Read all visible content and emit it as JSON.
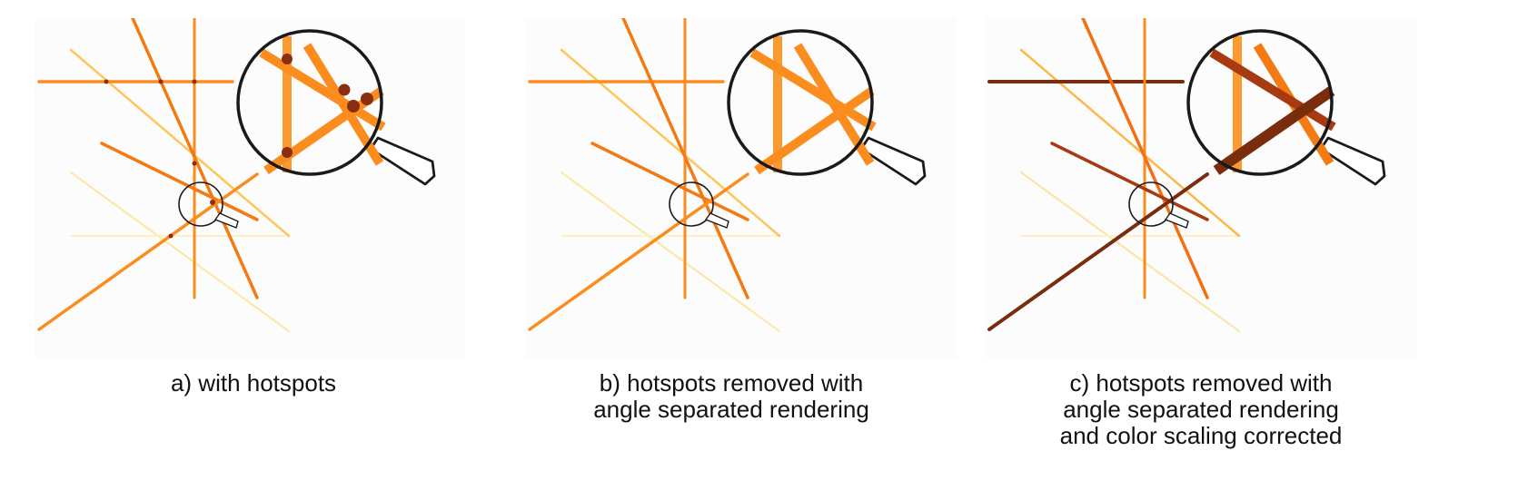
{
  "figure": {
    "panels": [
      {
        "id": "a",
        "caption_lines": [
          "a) with hotspots"
        ],
        "variant": "hotspots"
      },
      {
        "id": "b",
        "caption_lines": [
          "b) hotspots removed with",
          "angle separated rendering"
        ],
        "variant": "angle-separated"
      },
      {
        "id": "c",
        "caption_lines": [
          "c) hotspots removed with",
          "angle separated rendering",
          "and color scaling corrected"
        ],
        "variant": "color-corrected"
      }
    ]
  },
  "colors": {
    "background": "#fdfcfc",
    "line_bright": "#fb8c1e",
    "line_medium": "#fdb84a",
    "line_pale": "#fde6a0",
    "hotspot": "#8a2e10",
    "dark_line": "#7a2d0c",
    "dark_line_2": "#a83a12",
    "magnifier": "#1a1a1a"
  }
}
